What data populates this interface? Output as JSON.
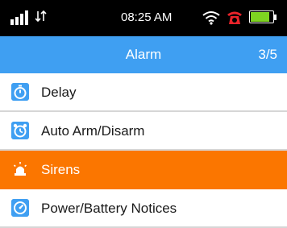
{
  "status_bar": {
    "time": "08:25 AM",
    "icons": [
      "signal-icon",
      "data-arrows-icon",
      "wifi-icon",
      "alarm-clock-icon",
      "battery-icon"
    ],
    "battery_level": 0.85,
    "battery_color": "#7ed321"
  },
  "header": {
    "title": "Alarm",
    "page_indicator": "3/5",
    "background": "#3f9ff2"
  },
  "menu": {
    "items": [
      {
        "label": "Delay",
        "icon": "stopwatch-icon",
        "selected": false
      },
      {
        "label": "Auto Arm/Disarm",
        "icon": "alarm-clock-icon",
        "selected": false
      },
      {
        "label": "Sirens",
        "icon": "siren-icon",
        "selected": true
      },
      {
        "label": "Power/Battery Notices",
        "icon": "power-gauge-icon",
        "selected": false
      }
    ],
    "selected_color": "#fb7600"
  }
}
